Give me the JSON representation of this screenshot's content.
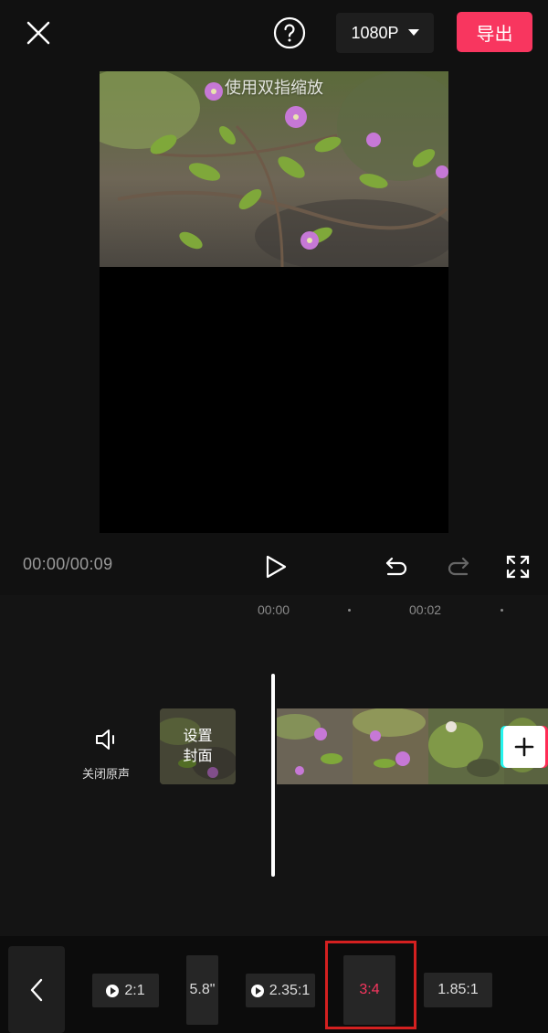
{
  "header": {
    "resolution_label": "1080P",
    "export_label": "导出"
  },
  "preview": {
    "hint": "使用双指缩放"
  },
  "playback": {
    "time": "00:00/00:09"
  },
  "timeline": {
    "ruler": [
      "00:00",
      "00:02"
    ],
    "mute_label": "关闭原声",
    "cover_label": "设置\n封面"
  },
  "ratio_bar": {
    "options": [
      {
        "label": "2:1",
        "has_icon": true
      },
      {
        "label": "5.8\"",
        "has_icon": false
      },
      {
        "label": "2.35:1",
        "has_icon": true
      },
      {
        "label": "3:4",
        "has_icon": false,
        "selected": true
      },
      {
        "label": "1.85:1",
        "has_icon": false
      }
    ]
  },
  "colors": {
    "accent": "#f8365f",
    "background": "#111111",
    "highlight_box": "#d42020"
  },
  "icons": [
    "close-icon",
    "help-icon",
    "caret-down-icon",
    "play-icon",
    "undo-icon",
    "redo-icon",
    "fullscreen-icon",
    "speaker-icon",
    "plus-icon",
    "chevron-left-icon"
  ]
}
